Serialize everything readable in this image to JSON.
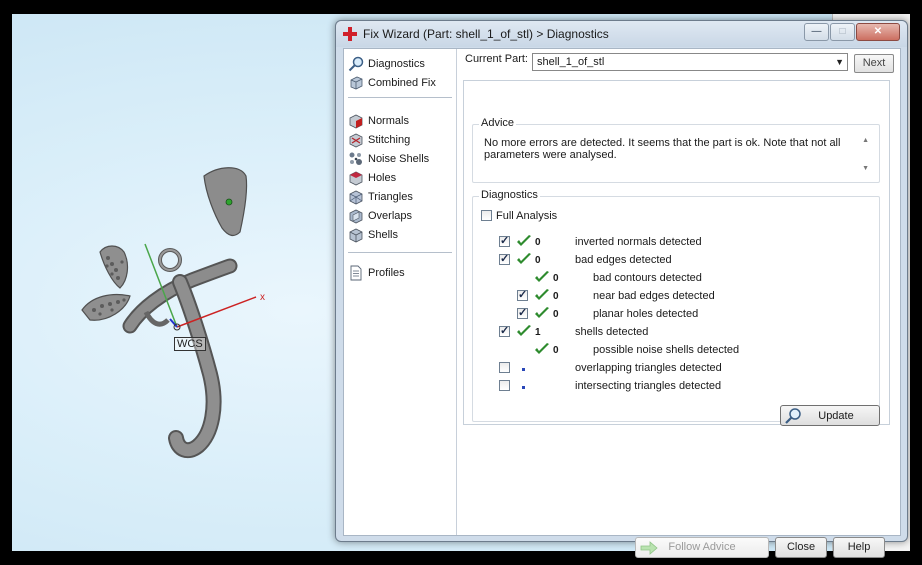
{
  "window": {
    "title": "Fix Wizard (Part: shell_1_of_stl) > Diagnostics",
    "minimize_glyph": "—",
    "maximize_glyph": "□",
    "close_glyph": "✕"
  },
  "viewport": {
    "wcs_label": "WCS",
    "axis_x_label": "x",
    "axis_colors": {
      "x": "#cc2222",
      "y": "#4aa64a",
      "z": "#2233cc"
    }
  },
  "nav": {
    "items": [
      {
        "label": "Diagnostics",
        "icon": "magnifier-icon",
        "selected": true
      },
      {
        "label": "Combined Fix",
        "icon": "cube-icon"
      },
      {
        "label": "Normals",
        "icon": "normals-cube-icon"
      },
      {
        "label": "Stitching",
        "icon": "stitching-icon"
      },
      {
        "label": "Noise Shells",
        "icon": "noise-shells-icon"
      },
      {
        "label": "Holes",
        "icon": "holes-cube-icon"
      },
      {
        "label": "Triangles",
        "icon": "triangles-cube-icon"
      },
      {
        "label": "Overlaps",
        "icon": "overlaps-cube-icon"
      },
      {
        "label": "Shells",
        "icon": "shells-cube-icon"
      },
      {
        "label": "Profiles",
        "icon": "document-icon"
      }
    ]
  },
  "current_part": {
    "label": "Current Part:",
    "value": "shell_1_of_stl",
    "next_label": "Next"
  },
  "advice": {
    "title": "Advice",
    "text": "No more errors are detected. It seems that the part is ok. Note that not all parameters were analysed."
  },
  "diagnostics": {
    "title": "Diagnostics",
    "full_analysis_label": "Full Analysis",
    "full_analysis_checked": false,
    "rows": [
      {
        "checkbox": true,
        "checked": true,
        "status": "ok",
        "count": "0",
        "label": "inverted normals detected",
        "indent": 0
      },
      {
        "checkbox": true,
        "checked": true,
        "status": "ok",
        "count": "0",
        "label": "bad edges detected",
        "indent": 0
      },
      {
        "checkbox": false,
        "checked": false,
        "status": "ok",
        "count": "0",
        "label": "bad contours detected",
        "indent": 1
      },
      {
        "checkbox": true,
        "checked": true,
        "status": "ok",
        "count": "0",
        "label": "near bad edges detected",
        "indent": 1
      },
      {
        "checkbox": true,
        "checked": true,
        "status": "ok",
        "count": "0",
        "label": "planar holes detected",
        "indent": 1
      },
      {
        "checkbox": true,
        "checked": true,
        "status": "ok",
        "count": "1",
        "label": "shells detected",
        "indent": 0
      },
      {
        "checkbox": false,
        "checked": false,
        "status": "ok",
        "count": "0",
        "label": "possible noise shells detected",
        "indent": 1
      },
      {
        "checkbox": true,
        "checked": false,
        "status": "unknown",
        "count": "",
        "label": "overlapping triangles detected",
        "indent": 0
      },
      {
        "checkbox": true,
        "checked": false,
        "status": "unknown",
        "count": "",
        "label": "intersecting triangles detected",
        "indent": 0
      }
    ],
    "update_label": "Update"
  },
  "footer": {
    "follow_advice_label": "Follow Advice",
    "close_label": "Close",
    "help_label": "Help"
  },
  "colors": {
    "check_green": "#2e8b2e",
    "dialog_frame": "#cfdcea",
    "accent_blue": "#2a47b8"
  }
}
